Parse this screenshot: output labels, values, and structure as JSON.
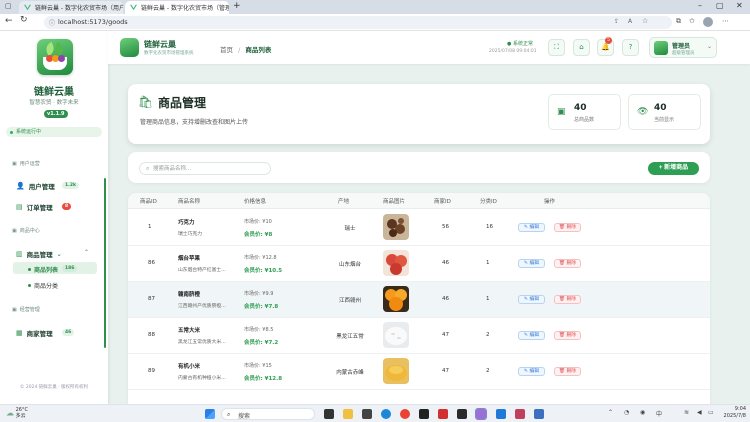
{
  "browser": {
    "tabs": [
      {
        "title": "链鲜云巢 - 数字化农贸市场（用户",
        "active": false
      },
      {
        "title": "链鲜云巢 - 数字化农贸市场（管理",
        "active": true
      }
    ],
    "url": "localhost:5173/goods"
  },
  "sidebar": {
    "brand": "链鲜云巢",
    "slogan": "智慧农贸 · 数字未来",
    "version": "v1.1.9",
    "system_status": "系统运行中",
    "groups": [
      {
        "label": "用户运营",
        "items": [
          {
            "label": "用户管理",
            "count": "1.2k"
          },
          {
            "label": "订单管理",
            "count": "8"
          }
        ]
      },
      {
        "label": "商品中心",
        "items": [
          {
            "label": "商品管理",
            "expanded": true,
            "children": [
              {
                "label": "商品列表",
                "count": "186",
                "active": true
              },
              {
                "label": "商品分类"
              }
            ]
          }
        ]
      },
      {
        "label": "经营管理",
        "items": [
          {
            "label": "商家管理",
            "count": "46"
          }
        ]
      }
    ],
    "copyright": "© 2024 链鲜云巢 · 版权所有权利"
  },
  "header": {
    "title": "链鲜云巢",
    "subtitle": "数字化农贸市场管理系统",
    "breadcrumb": [
      "首页",
      "商品列表"
    ],
    "status": "系统正常",
    "datetime": "2025/07/08 09:04:01",
    "notifications": "5",
    "user_name": "管理员",
    "user_role": "超级管理员"
  },
  "page": {
    "title": "商品管理",
    "description": "管理商品信息，支持增删改查和图片上传",
    "stats": [
      {
        "value": "40",
        "label": "总商品数"
      },
      {
        "value": "40",
        "label": "当前显示"
      }
    ],
    "search_placeholder": "搜索商品名称...",
    "add_button": "+ 新增商品"
  },
  "table": {
    "columns": [
      "商品ID",
      "商品名称",
      "价格信息",
      "产地",
      "商品图片",
      "商家ID",
      "分类ID",
      "操作"
    ],
    "market_prefix": "市场价:",
    "member_prefix": "会员价:",
    "edit_label": "编辑",
    "delete_label": "删除",
    "rows": [
      {
        "id": "1",
        "name": "巧克力",
        "desc": "瑞士巧克力",
        "market": "¥10",
        "member": "¥8",
        "origin": "瑞士",
        "merchant": "56",
        "category": "16",
        "image": "chocolate"
      },
      {
        "id": "86",
        "name": "烟台苹果",
        "desc": "山东烟台特产红富士...",
        "market": "¥12.8",
        "member": "¥10.5",
        "origin": "山东烟台",
        "merchant": "46",
        "category": "1",
        "image": "apple"
      },
      {
        "id": "87",
        "name": "赣南脐橙",
        "desc": "江西赣州产优质脐橙...",
        "market": "¥9.9",
        "member": "¥7.8",
        "origin": "江西赣州",
        "merchant": "46",
        "category": "1",
        "image": "orange"
      },
      {
        "id": "88",
        "name": "五常大米",
        "desc": "黑龙江五常优质大米...",
        "market": "¥8.5",
        "member": "¥7.2",
        "origin": "黑龙江五常",
        "merchant": "47",
        "category": "2",
        "image": "rice"
      },
      {
        "id": "89",
        "name": "有机小米",
        "desc": "内蒙古有机种植小米...",
        "market": "¥15",
        "member": "¥12.8",
        "origin": "内蒙古赤峰",
        "merchant": "47",
        "category": "2",
        "image": "millet"
      }
    ]
  },
  "taskbar": {
    "weather_temp": "26°C",
    "weather_desc": "多云",
    "search_label": "搜索",
    "time": "9:04",
    "date": "2025/7/8"
  },
  "colors": {
    "primary": "#2f9e55",
    "brand_dark": "#1f5f3a",
    "danger": "#e05555",
    "info": "#3a7bd5"
  }
}
